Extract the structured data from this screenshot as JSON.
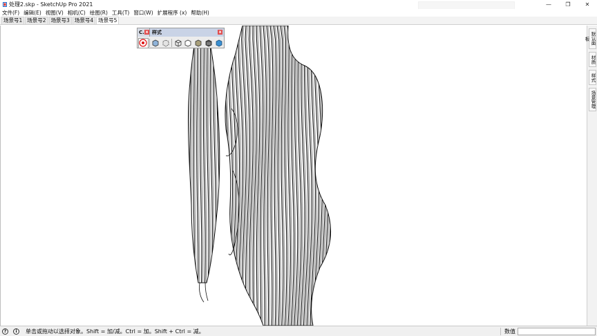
{
  "window": {
    "title": "处理2.skp - SketchUp Pro 2021",
    "minimize_glyph": "—",
    "maximize_glyph": "❐",
    "close_glyph": "✕"
  },
  "menu": [
    {
      "label": "文件(F)"
    },
    {
      "label": "编辑(E)"
    },
    {
      "label": "视图(V)"
    },
    {
      "label": "相机(C)"
    },
    {
      "label": "绘图(R)"
    },
    {
      "label": "工具(T)"
    },
    {
      "label": "窗口(W)"
    },
    {
      "label": "扩展程序 (x)"
    },
    {
      "label": "帮助(H)"
    }
  ],
  "scene_tabs": [
    {
      "label": "场景号1"
    },
    {
      "label": "场景号2"
    },
    {
      "label": "场景号3"
    },
    {
      "label": "场景号4"
    },
    {
      "label": "场景号5"
    }
  ],
  "active_scene_index": 4,
  "styles_toolbar": {
    "collapsed_title": "C.",
    "title": "样式",
    "close_glyph": "x",
    "tools": [
      {
        "icon": "xray-icon"
      },
      {
        "icon": "back-edges-icon"
      },
      {
        "icon": "wireframe-icon"
      },
      {
        "icon": "hidden-line-icon"
      },
      {
        "icon": "shaded-icon"
      },
      {
        "icon": "shaded-with-textures-icon"
      },
      {
        "icon": "monochrome-icon"
      }
    ]
  },
  "right_tray": [
    {
      "label": "默认面板"
    },
    {
      "label": "材质"
    },
    {
      "label": "样式"
    },
    {
      "label": "场景管理"
    }
  ],
  "status": {
    "hint": "单击或拖动以选择对象。Shift = 加/减。Ctrl = 加。Shift + Ctrl = 减。",
    "measure_label": "数值",
    "measure_value": "",
    "info_glyph": "?",
    "credits_glyph": "i"
  },
  "colors": {
    "accent": "#1a73e8",
    "close_red": "#e04b4b",
    "model_line": "#111111"
  }
}
